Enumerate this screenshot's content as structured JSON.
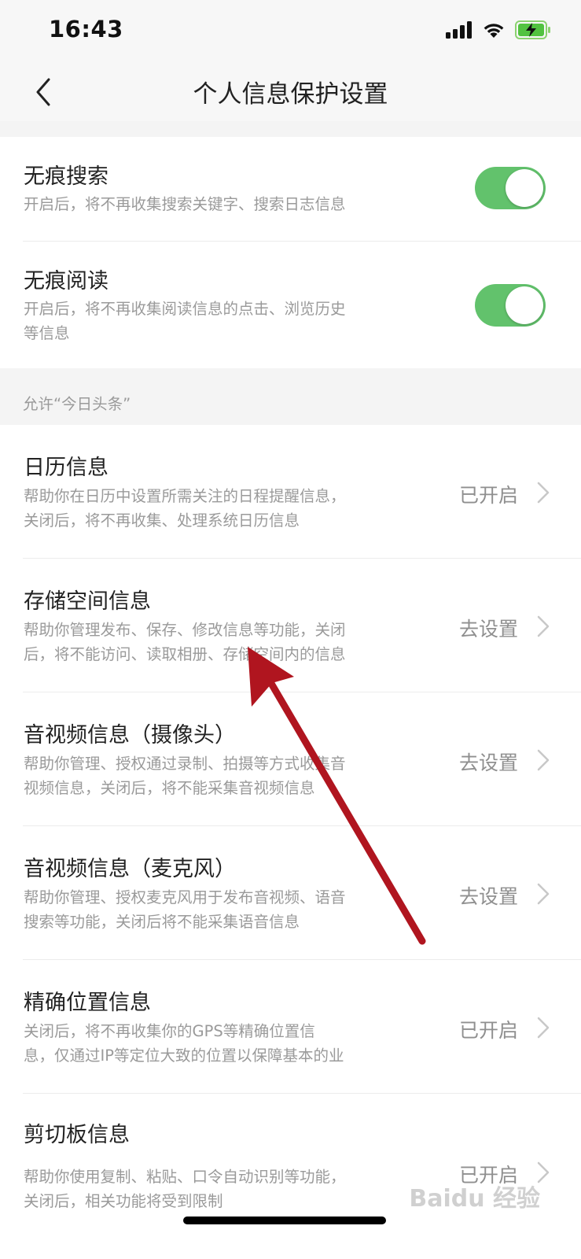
{
  "status_bar": {
    "time": "16:43"
  },
  "nav": {
    "title": "个人信息保护设置"
  },
  "toggles": [
    {
      "title": "无痕搜索",
      "desc": [
        "开启后，将不再收集搜索关键字、搜索日志信息"
      ],
      "on": true
    },
    {
      "title": "无痕阅读",
      "desc": [
        "开启后，将不再收集阅读信息的点击、浏览历史",
        "等信息"
      ],
      "on": true
    }
  ],
  "section_header": "允许“今日头条”",
  "permissions": [
    {
      "title": "日历信息",
      "desc": [
        "帮助你在日历中设置所需关注的日程提醒信息，",
        "关闭后，将不再收集、处理系统日历信息"
      ],
      "status": "已开启"
    },
    {
      "title": "存储空间信息",
      "desc": [
        "帮助你管理发布、保存、修改信息等功能，关闭",
        "后，将不能访问、读取相册、存储空间内的信息"
      ],
      "status": "去设置"
    },
    {
      "title": "音视频信息（摄像头）",
      "desc": [
        "帮助你管理、授权通过录制、拍摄等方式收集音",
        "视频信息，关闭后，将不能采集音视频信息"
      ],
      "status": "去设置"
    },
    {
      "title": "音视频信息（麦克风）",
      "desc": [
        "帮助你管理、授权麦克风用于发布音视频、语音",
        "搜索等功能，关闭后将不能采集语音信息"
      ],
      "status": "去设置"
    },
    {
      "title": "精确位置信息",
      "desc": [
        "关闭后，将不再收集你的GPS等精确位置信",
        "息，仅通过IP等定位大致的位置以保障基本的业"
      ],
      "status": "已开启"
    },
    {
      "title": "剪切板信息",
      "desc": [
        "帮助你使用复制、粘贴、口令自动识别等功能，",
        "关闭后，相关功能将受到限制"
      ],
      "status": "已开启"
    }
  ],
  "watermark": "Baidu 经验",
  "colors": {
    "toggle_on": "#62c26c",
    "arrow": "#b0151f",
    "background": "#ffffff",
    "band": "#f4f4f4"
  }
}
